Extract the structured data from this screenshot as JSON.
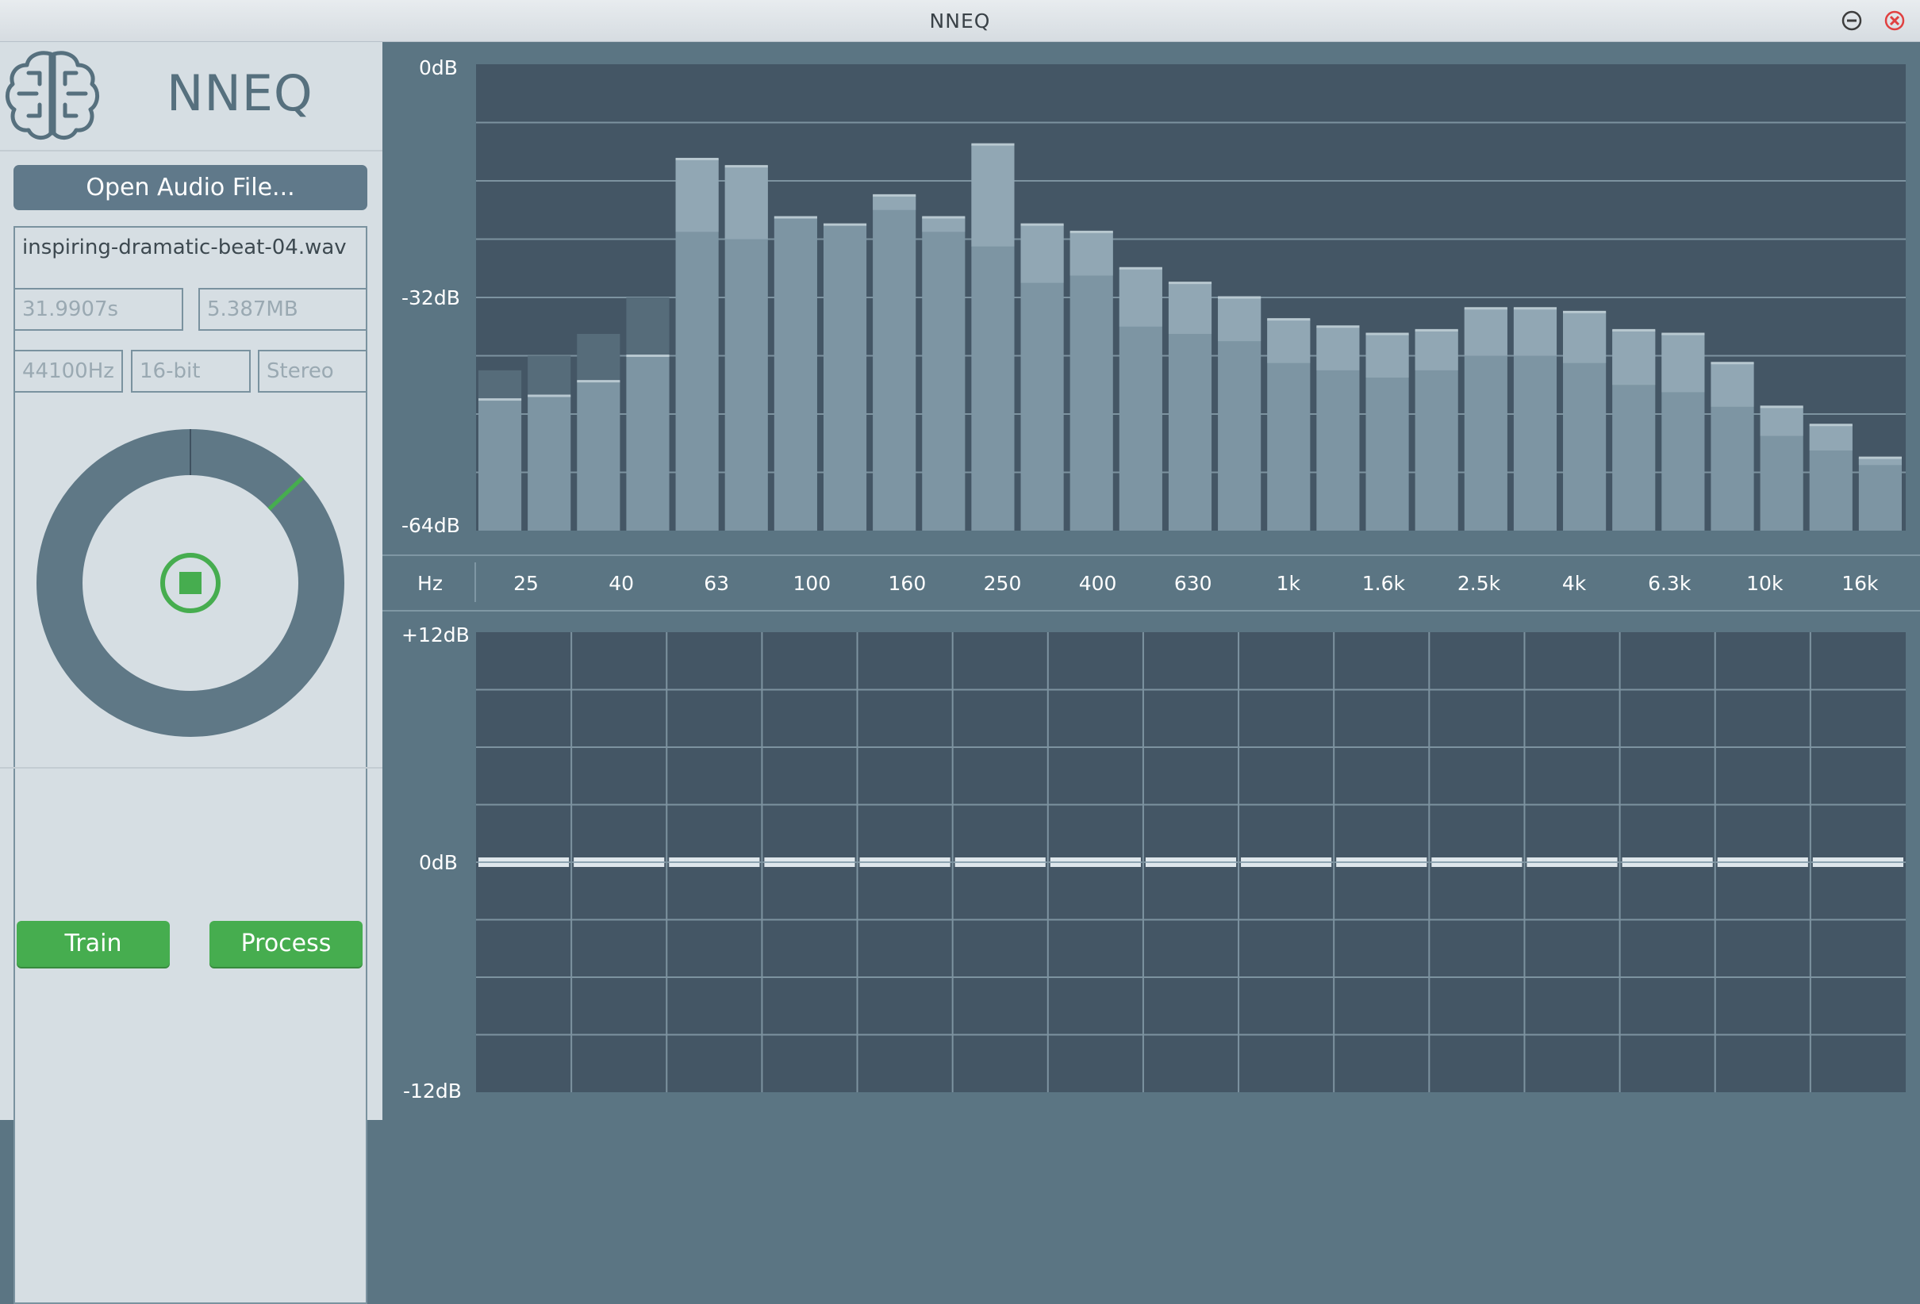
{
  "window": {
    "title": "NNEQ"
  },
  "app": {
    "name": "NNEQ"
  },
  "file": {
    "open_label": "Open Audio File...",
    "name": "inspiring-dramatic-beat-04.wav",
    "duration": "31.9907s",
    "size": "5.387MB",
    "sample_rate": "44100Hz",
    "bit_depth": "16-bit",
    "channels": "Stereo"
  },
  "buttons": {
    "train": "Train",
    "process": "Process"
  },
  "spectrum": {
    "top_label": "0dB",
    "mid_label": "-32dB",
    "bottom_label": "-64dB",
    "db_min": -64,
    "db_max": 0,
    "levels_db": [
      -46,
      -45.5,
      -43.5,
      -40,
      -13,
      -14,
      -21,
      -22,
      -18,
      -21,
      -11,
      -22,
      -23,
      -28,
      -30,
      -32,
      -35,
      -36,
      -37,
      -36.5,
      -33.5,
      -33.5,
      -34,
      -36.5,
      -37,
      -41,
      -47,
      -49.5,
      -54
    ],
    "peaks_db": [
      -42,
      -40,
      -37,
      -32,
      -13,
      -14,
      -21,
      -22,
      -18,
      -21,
      -11,
      -22,
      -23,
      -28,
      -30,
      -32,
      -35,
      -36,
      -37,
      -36.5,
      -33.5,
      -33.5,
      -34,
      -36.5,
      -37,
      -41,
      -47,
      -49.5,
      -54
    ],
    "averages_db": [
      -46,
      -45.5,
      -43.5,
      -40,
      -23,
      -24,
      -21,
      -22,
      -20,
      -23,
      -25,
      -30,
      -29,
      -36,
      -37,
      -38,
      -41,
      -42,
      -43,
      -42,
      -40,
      -40,
      -41,
      -44,
      -45,
      -47,
      -51,
      -53,
      -55
    ]
  },
  "frequency_axis": {
    "unit_label": "Hz",
    "ticks": [
      "25",
      "40",
      "63",
      "100",
      "160",
      "250",
      "400",
      "630",
      "1k",
      "1.6k",
      "2.5k",
      "4k",
      "6.3k",
      "10k",
      "16k"
    ]
  },
  "eq": {
    "top_label": "+12dB",
    "mid_label": "0dB",
    "bottom_label": "-12dB",
    "gains_db": [
      0,
      0,
      0,
      0,
      0,
      0,
      0,
      0,
      0,
      0,
      0,
      0,
      0,
      0,
      0
    ]
  },
  "dial": {
    "progress_fraction": 0.13
  },
  "colors": {
    "accent_green": "#46ad4f",
    "panel_dark": "#445665",
    "frame": "#5b7583",
    "sidebar": "#d6dee3",
    "close": "#e04040"
  },
  "icons": {
    "logo": "brain-icon",
    "minimize": "minimize-icon",
    "close": "close-icon",
    "stop": "stop-icon"
  }
}
